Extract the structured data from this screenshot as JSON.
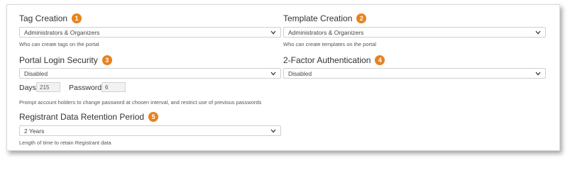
{
  "tag_creation": {
    "label": "Tag Creation",
    "badge": "1",
    "selected": "Administrators & Organizers",
    "help": "Who can create tags on the portal"
  },
  "template_creation": {
    "label": "Template Creation",
    "badge": "2",
    "selected": "Administrators & Organizers",
    "help": "Who can create templates on the portal"
  },
  "portal_login_security": {
    "label": "Portal Login Security",
    "badge": "3",
    "selected": "Disabled",
    "days_label": "Days",
    "days_value": "215",
    "passwords_label": "Passwords",
    "passwords_value": "6",
    "help": "Prompt account holders to change password at chosen interval, and restrict use of previous passwords"
  },
  "two_factor": {
    "label": "2-Factor Authentication",
    "badge": "4",
    "selected": "Disabled"
  },
  "registrant_retention": {
    "label": "Registrant Data Retention Period",
    "badge": "5",
    "selected": "2 Years",
    "help": "Length of time to retain Registrant data"
  },
  "colors": {
    "badge": "#e8821e"
  }
}
